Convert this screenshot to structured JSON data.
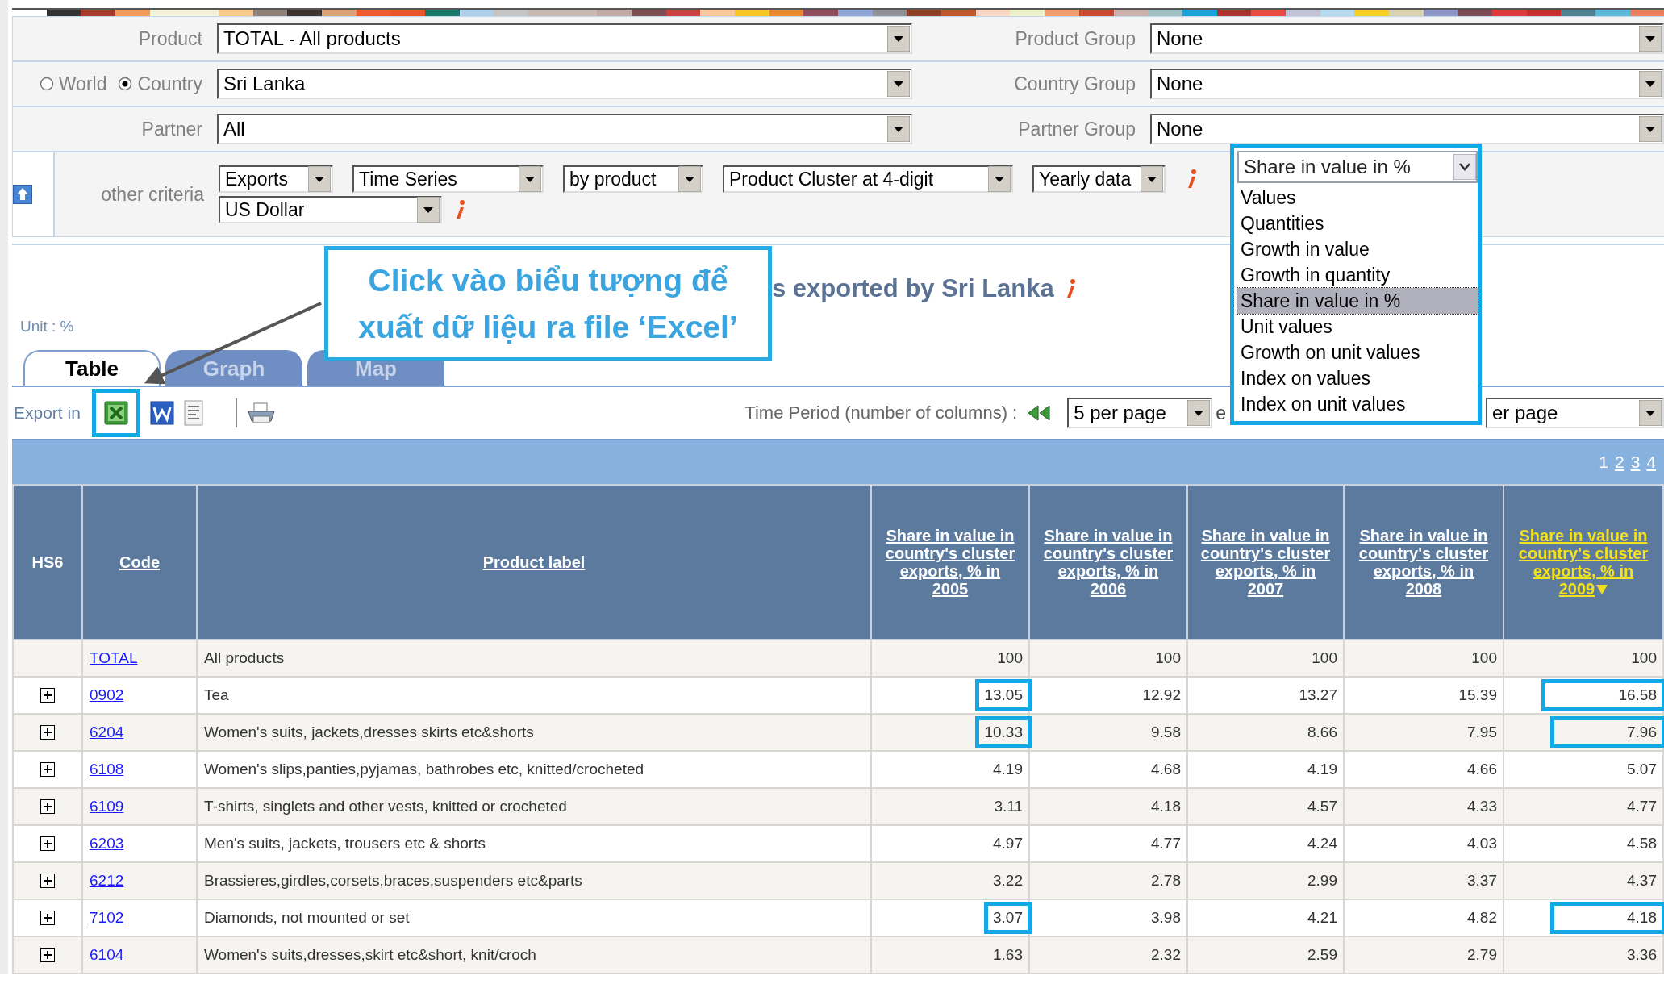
{
  "filters": [
    {
      "kind": "label",
      "label": "Product",
      "value": "TOTAL - All products",
      "group_label": "Product Group",
      "group_value": "None"
    },
    {
      "kind": "scope",
      "options": [
        {
          "label": "World",
          "selected": false
        },
        {
          "label": "Country",
          "selected": true
        }
      ],
      "value": "Sri Lanka",
      "group_label": "Country Group",
      "group_value": "None"
    },
    {
      "kind": "label",
      "label": "Partner",
      "value": "All",
      "group_label": "Partner Group",
      "group_value": "None"
    }
  ],
  "criteria": {
    "label": "other criteria",
    "lines": [
      {
        "selects": [
          "Exports",
          "Time Series",
          "by product",
          "Product Cluster at 4-digit",
          "Yearly data"
        ]
      },
      {
        "selects": [
          "US Dollar"
        ]
      }
    ]
  },
  "indicator_dropdown": {
    "value": "Share in value in %",
    "options": [
      {
        "label": "Values",
        "selected": false
      },
      {
        "label": "Quantities",
        "selected": false
      },
      {
        "label": "Growth in value",
        "selected": false
      },
      {
        "label": "Growth in quantity",
        "selected": false
      },
      {
        "label": "Share in value in %",
        "selected": true
      },
      {
        "label": "Unit values",
        "selected": false
      },
      {
        "label": "Growth on unit values",
        "selected": false
      },
      {
        "label": "Index on values",
        "selected": false
      },
      {
        "label": "Index on unit values",
        "selected": false
      }
    ]
  },
  "title": "s exported by Sri Lanka",
  "callout": {
    "text": "Click vào biểu tượng để\nxuất dữ liệu ra file ‘Excel’"
  },
  "unit": "Unit : %",
  "tabs": [
    {
      "label": "Table",
      "selected": true
    },
    {
      "label": "Graph",
      "selected": false
    },
    {
      "label": "Map",
      "selected": false
    }
  ],
  "export": {
    "label": "Export in",
    "excel_boxed": true
  },
  "time_period": {
    "label": "Time Period (number of columns) :",
    "per_page": "5 per page",
    "rows_label": "e",
    "rows_per_page": "er page"
  },
  "pages": [
    {
      "label": "1",
      "selected": true
    },
    {
      "label": "2",
      "selected": false
    },
    {
      "label": "3",
      "selected": false
    },
    {
      "label": "4",
      "selected": false
    }
  ],
  "table": {
    "columns": [
      {
        "label": "HS6",
        "link": false,
        "sorted": false
      },
      {
        "label": "Code",
        "link": true,
        "sorted": false
      },
      {
        "label": "Product label",
        "link": true,
        "sorted": false
      },
      {
        "label": "Share in value in country's cluster exports, % in 2005",
        "link": true,
        "sorted": false
      },
      {
        "label": "Share in value in country's cluster exports, % in 2006",
        "link": true,
        "sorted": false
      },
      {
        "label": "Share in value in country's cluster exports, % in 2007",
        "link": true,
        "sorted": false
      },
      {
        "label": "Share in value in country's cluster exports, % in 2008",
        "link": true,
        "sorted": false
      },
      {
        "label": "Share in value in country's cluster exports, % in 2009",
        "link": true,
        "sorted": true
      }
    ],
    "rows": [
      {
        "expandable": false,
        "code": "TOTAL",
        "label": "All products",
        "values": [
          {
            "text": "100",
            "boxed": false
          },
          {
            "text": "100",
            "boxed": false
          },
          {
            "text": "100",
            "boxed": false
          },
          {
            "text": "100",
            "boxed": false
          },
          {
            "text": "100",
            "boxed": false
          }
        ]
      },
      {
        "expandable": true,
        "code": "0902",
        "label": "Tea",
        "values": [
          {
            "text": "13.05",
            "boxed": true
          },
          {
            "text": "12.92",
            "boxed": false
          },
          {
            "text": "13.27",
            "boxed": false
          },
          {
            "text": "15.39",
            "boxed": false
          },
          {
            "text": "16.58",
            "boxed": true
          }
        ]
      },
      {
        "expandable": true,
        "code": "6204",
        "label": "Women's suits, jackets,dresses skirts etc&shorts",
        "values": [
          {
            "text": "10.33",
            "boxed": true
          },
          {
            "text": "9.58",
            "boxed": false
          },
          {
            "text": "8.66",
            "boxed": false
          },
          {
            "text": "7.95",
            "boxed": false
          },
          {
            "text": "7.96",
            "boxed": true
          }
        ]
      },
      {
        "expandable": true,
        "code": "6108",
        "label": "Women's slips,panties,pyjamas, bathrobes etc, knitted/crocheted",
        "values": [
          {
            "text": "4.19",
            "boxed": false
          },
          {
            "text": "4.68",
            "boxed": false
          },
          {
            "text": "4.19",
            "boxed": false
          },
          {
            "text": "4.66",
            "boxed": false
          },
          {
            "text": "5.07",
            "boxed": false
          }
        ]
      },
      {
        "expandable": true,
        "code": "6109",
        "label": "T-shirts, singlets and other vests, knitted or crocheted",
        "values": [
          {
            "text": "3.11",
            "boxed": false
          },
          {
            "text": "4.18",
            "boxed": false
          },
          {
            "text": "4.57",
            "boxed": false
          },
          {
            "text": "4.33",
            "boxed": false
          },
          {
            "text": "4.77",
            "boxed": false
          }
        ]
      },
      {
        "expandable": true,
        "code": "6203",
        "label": "Men's suits, jackets, trousers etc & shorts",
        "values": [
          {
            "text": "4.97",
            "boxed": false
          },
          {
            "text": "4.77",
            "boxed": false
          },
          {
            "text": "4.24",
            "boxed": false
          },
          {
            "text": "4.03",
            "boxed": false
          },
          {
            "text": "4.58",
            "boxed": false
          }
        ]
      },
      {
        "expandable": true,
        "code": "6212",
        "label": "Brassieres,girdles,corsets,braces,suspenders etc&parts",
        "values": [
          {
            "text": "3.22",
            "boxed": false
          },
          {
            "text": "2.78",
            "boxed": false
          },
          {
            "text": "2.99",
            "boxed": false
          },
          {
            "text": "3.37",
            "boxed": false
          },
          {
            "text": "4.37",
            "boxed": false
          }
        ]
      },
      {
        "expandable": true,
        "code": "7102",
        "label": "Diamonds, not mounted or set",
        "values": [
          {
            "text": "3.07",
            "boxed": true
          },
          {
            "text": "3.98",
            "boxed": false
          },
          {
            "text": "4.21",
            "boxed": false
          },
          {
            "text": "4.82",
            "boxed": false
          },
          {
            "text": "4.18",
            "boxed": true
          }
        ]
      },
      {
        "expandable": true,
        "code": "6104",
        "label": "Women's suits,dresses,skirt etc&short, knit/croch",
        "values": [
          {
            "text": "1.63",
            "boxed": false
          },
          {
            "text": "2.32",
            "boxed": false
          },
          {
            "text": "2.59",
            "boxed": false
          },
          {
            "text": "2.79",
            "boxed": false
          },
          {
            "text": "3.36",
            "boxed": false
          }
        ]
      }
    ]
  }
}
